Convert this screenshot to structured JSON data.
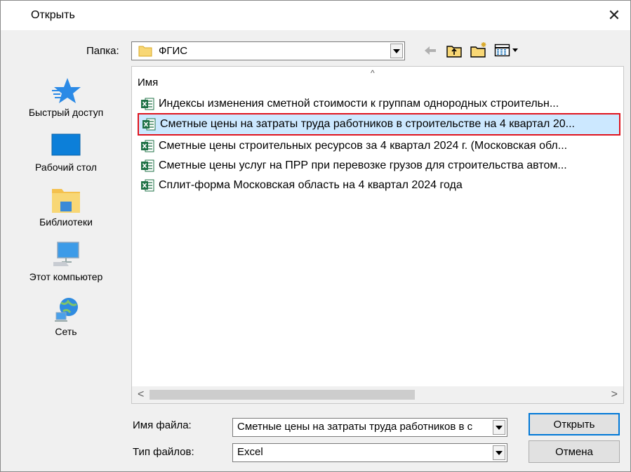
{
  "dialog": {
    "title": "Открыть",
    "close_glyph": "✕"
  },
  "folder": {
    "label": "Папка:",
    "value": "ФГИС"
  },
  "toolbar": {
    "back_icon": "back-arrow-icon",
    "up_icon": "folder-up-icon",
    "new_folder_icon": "new-folder-icon",
    "view_icon": "view-menu-icon"
  },
  "sidebar": {
    "items": [
      {
        "label": "Быстрый доступ",
        "icon": "quick-access-star-icon"
      },
      {
        "label": "Рабочий стол",
        "icon": "desktop-icon"
      },
      {
        "label": "Библиотеки",
        "icon": "libraries-icon"
      },
      {
        "label": "Этот компьютер",
        "icon": "computer-icon"
      },
      {
        "label": "Сеть",
        "icon": "network-icon"
      }
    ]
  },
  "filelist": {
    "column_header": "Имя",
    "sort_glyph": "^",
    "files": [
      {
        "name": "Индексы изменения сметной стоимости к группам однородных строительн..."
      },
      {
        "name": "Сметные цены на затраты труда работников в строительстве на 4 квартал 20..."
      },
      {
        "name": "Сметные цены строительных ресурсов за 4 квартал 2024 г. (Московская обл..."
      },
      {
        "name": "Сметные цены услуг на ПРР при перевозке грузов для строительства автом..."
      },
      {
        "name": "Сплит-форма Московская область на 4 квартал 2024 года"
      }
    ],
    "selected_index": 1
  },
  "scrollbar": {
    "left_glyph": "<",
    "right_glyph": ">"
  },
  "filename": {
    "label": "Имя файла:",
    "value": "Сметные цены на затраты труда работников в с"
  },
  "filetype": {
    "label": "Тип файлов:",
    "value": "Excel"
  },
  "buttons": {
    "open": "Открыть",
    "cancel": "Отмена"
  },
  "colors": {
    "selection_bg": "#cce8ff",
    "selection_border": "#e0141e",
    "excel_green": "#1e7145",
    "default_button_border": "#0078d7"
  }
}
